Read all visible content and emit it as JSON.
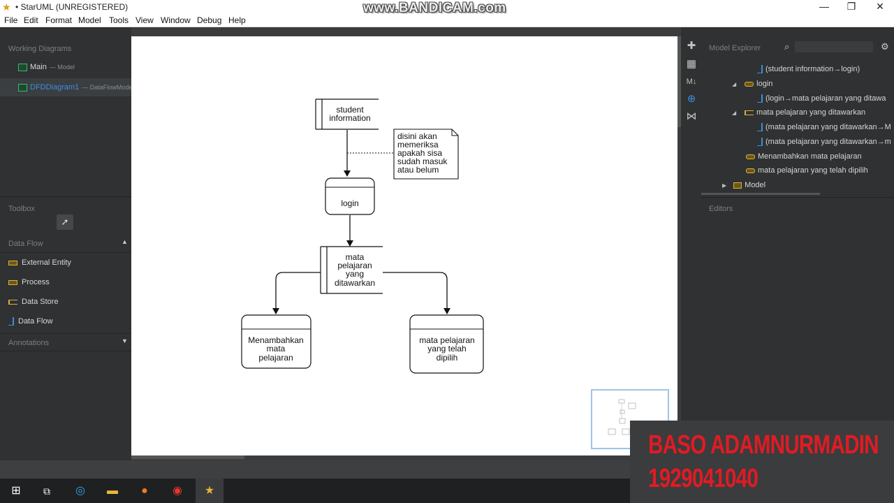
{
  "window": {
    "title": "• StarUML (UNREGISTERED)",
    "watermark": "www.BANDICAM.com",
    "minimize": "—",
    "restore": "❐",
    "close": "✕"
  },
  "menu": [
    "File",
    "Edit",
    "Format",
    "Model",
    "Tools",
    "View",
    "Window",
    "Debug",
    "Help"
  ],
  "working_diagrams": {
    "title": "Working Diagrams",
    "items": [
      {
        "label": "Main",
        "sub": "— Model"
      },
      {
        "label": "DFDDiagram1",
        "sub": "— DataFlowMode"
      }
    ]
  },
  "toolbox": {
    "title": "Toolbox",
    "section": "Data Flow",
    "items": [
      "External Entity",
      "Process",
      "Data Store",
      "Data Flow"
    ],
    "annotations": "Annotations"
  },
  "diagram": {
    "nodes": {
      "student_information": [
        "student",
        "information"
      ],
      "note": [
        "disini akan",
        "memeriksa",
        "apakah sisa",
        "sudah masuk",
        "atau belum"
      ],
      "login": [
        "login"
      ],
      "mata_pelajaran": [
        "mata",
        "pelajaran",
        "yang",
        "ditawarkan"
      ],
      "menambahkan": [
        "Menambahkan",
        "mata",
        "pelajaran"
      ],
      "dipilih": [
        "mata pelajaran",
        "yang telah",
        "dipilih"
      ]
    }
  },
  "model_explorer": {
    "title": "Model Explorer",
    "items": [
      "(student information→login)",
      "login",
      "(login→mata pelajaran yang ditawa",
      "mata pelajaran yang ditawarkan",
      "(mata pelajaran yang ditawarkan→M",
      "(mata pelajaran yang ditawarkan→m",
      "Menambahkan mata pelajaran",
      "mata pelajaran yang telah dipilih",
      "Model"
    ]
  },
  "editors": {
    "title": "Editors"
  },
  "overlay": {
    "name": "BASO ADAMNURMADIN",
    "nim": "1929041040"
  },
  "colors": {
    "canvas": "#ffffff",
    "panel": "#2f3132",
    "accent_red": "#e01b24"
  }
}
